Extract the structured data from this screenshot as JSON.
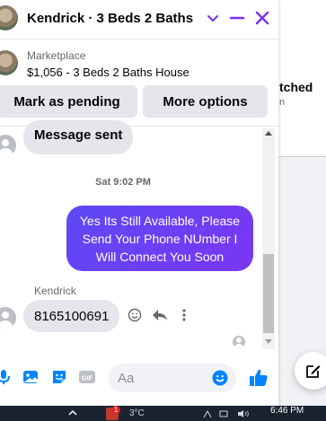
{
  "background": {
    "partial_text": "tched",
    "partial_subtext": "n"
  },
  "header": {
    "title": "Kendrick · 3 Beds 2 Baths ..."
  },
  "marketplace": {
    "label": "Marketplace",
    "title": "$1,056 - 3 Beds 2 Baths House"
  },
  "actions": {
    "pending_label": "Mark as pending",
    "more_label": "More options"
  },
  "messages": {
    "first": "Message sent",
    "timestamp": "Sat 9:02 PM",
    "sent": "Yes Its Still Available, Please Send Your Phone NUmber I Will Connect You Soon",
    "sender_name": "Kendrick",
    "reply": "8165100691"
  },
  "composer": {
    "placeholder": "Aa",
    "gif_label": "GIF"
  },
  "taskbar": {
    "badge": "1",
    "weather": "3°C",
    "time": "6:46 PM"
  },
  "colors": {
    "accent": "#7b2ff2",
    "messenger_blue": "#0084ff",
    "sent_bubble_start": "#5d49f5",
    "sent_bubble_end": "#7a36f2"
  }
}
